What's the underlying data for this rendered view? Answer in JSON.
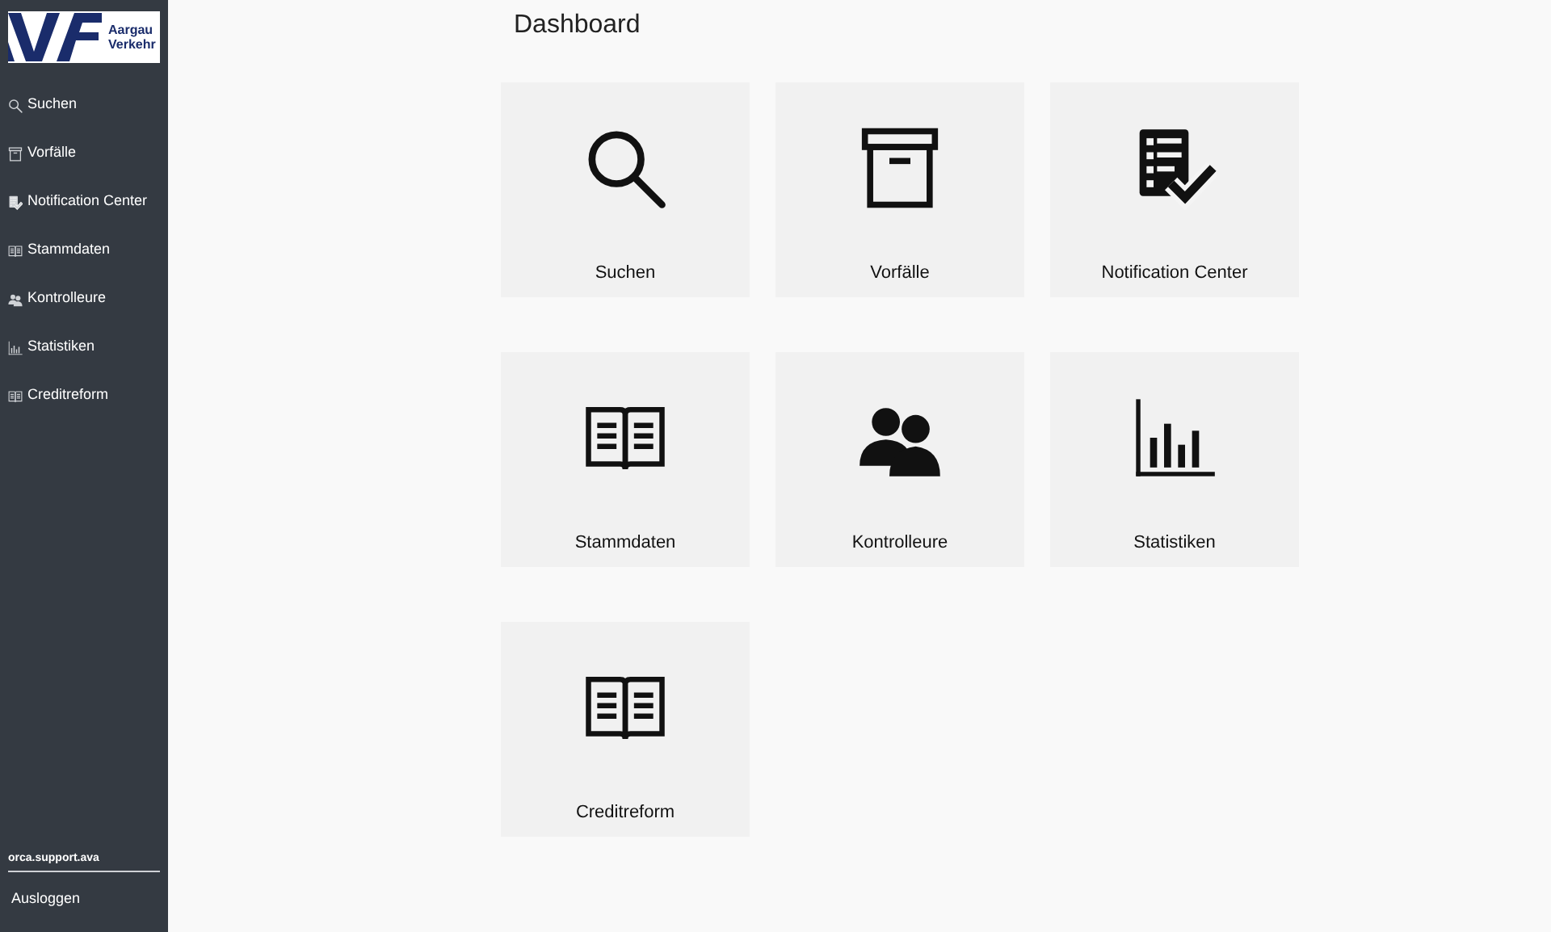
{
  "logo": {
    "line_1": "Aargau",
    "line_2": "Verkehr"
  },
  "sidebar": {
    "items": [
      {
        "label": "Suchen",
        "kind": "search"
      },
      {
        "label": "Vorfälle",
        "kind": "archive"
      },
      {
        "label": "Notification Center",
        "kind": "checklist"
      },
      {
        "label": "Stammdaten",
        "kind": "book"
      },
      {
        "label": "Kontrolleure",
        "kind": "users"
      },
      {
        "label": "Statistiken",
        "kind": "chart"
      },
      {
        "label": "Creditreform",
        "kind": "book"
      }
    ],
    "user": "orca.support.ava",
    "logout": "Ausloggen"
  },
  "page_title": "Dashboard",
  "tiles": [
    {
      "label": "Suchen",
      "kind": "search"
    },
    {
      "label": "Vorfälle",
      "kind": "archive"
    },
    {
      "label": "Notification Center",
      "kind": "checklist"
    },
    {
      "label": "Stammdaten",
      "kind": "book"
    },
    {
      "label": "Kontrolleure",
      "kind": "users"
    },
    {
      "label": "Statistiken",
      "kind": "chart"
    },
    {
      "label": "Creditreform",
      "kind": "book"
    }
  ]
}
